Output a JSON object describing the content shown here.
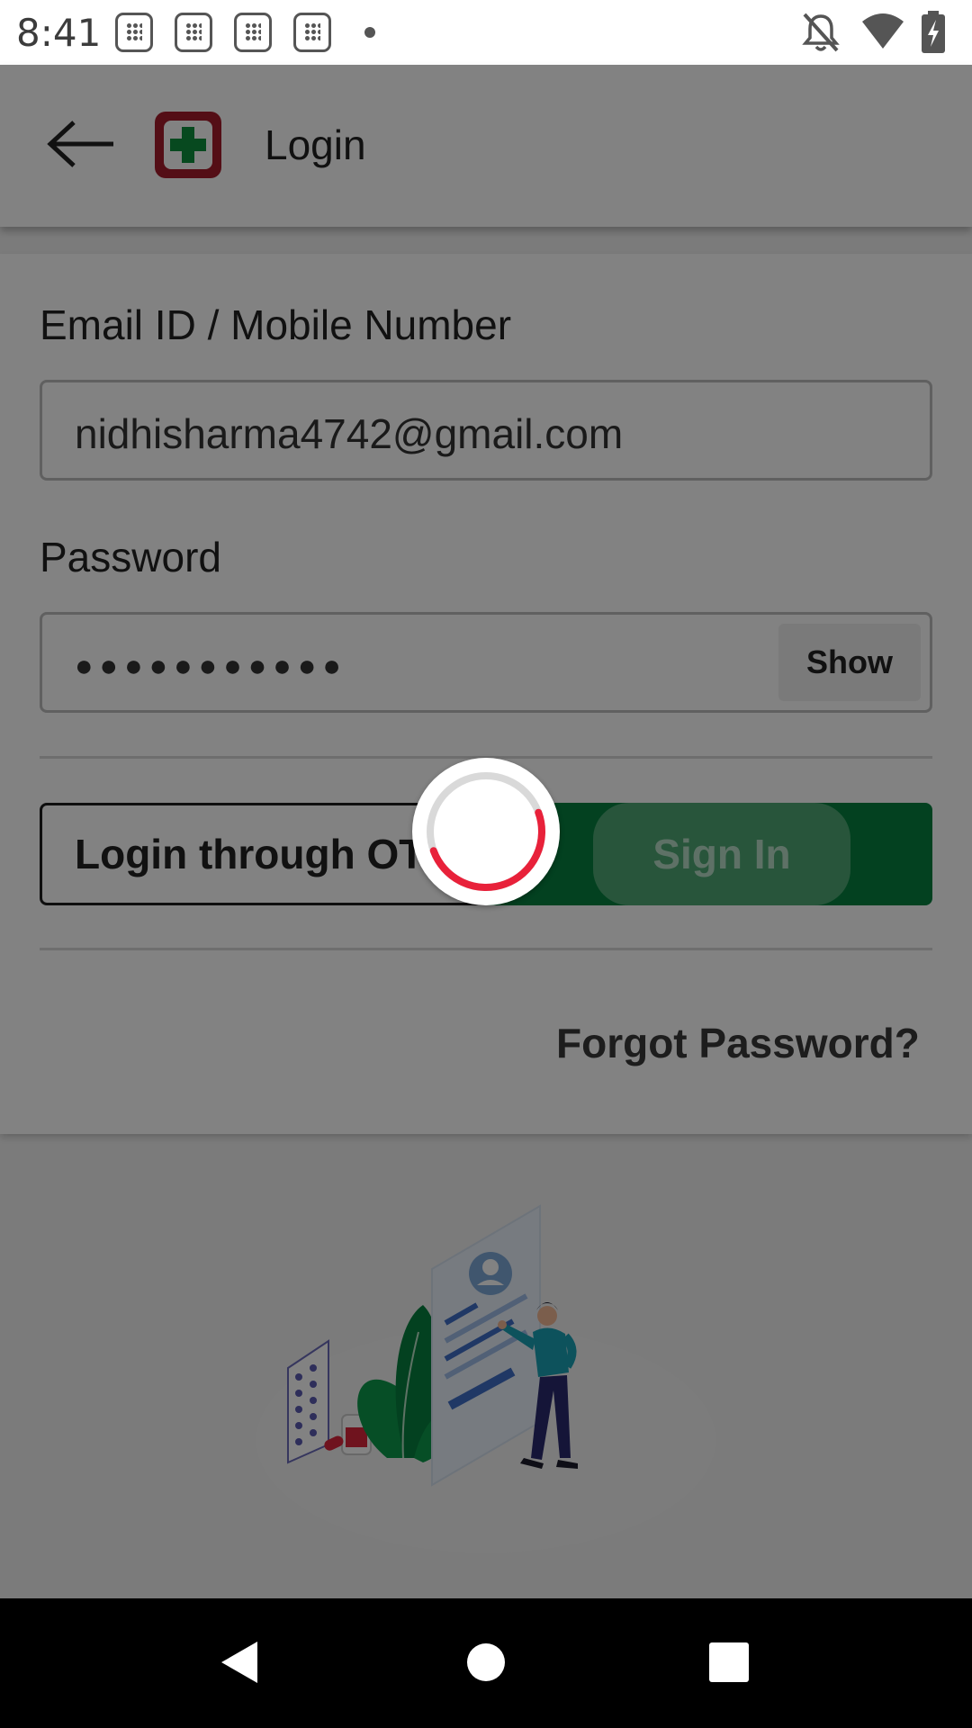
{
  "status_bar": {
    "time": "8:41",
    "left_icons": [
      "notification-icon",
      "notification-icon",
      "notification-icon",
      "notification-icon",
      "dot-icon"
    ],
    "right_icons": [
      "bell-off-icon",
      "wifi-icon",
      "battery-charging-icon"
    ]
  },
  "app_bar": {
    "back_icon": "arrow-left-icon",
    "logo_icon": "medical-cross-logo",
    "title": "Login"
  },
  "form": {
    "email_label": "Email ID / Mobile Number",
    "email_value": "nidhisharma4742@gmail.com",
    "password_label": "Password",
    "password_mask": "●●●●●●●●●●●",
    "show_label": "Show",
    "otp_label": "Login through OTP",
    "signin_label": "Sign In",
    "forgot_label": "Forgot Password?"
  },
  "loader": {
    "visible": true,
    "arc_color": "#e8213a",
    "track_color": "#d9d9d9"
  },
  "colors": {
    "brand_red": "#a51c2b",
    "brand_green": "#07803f",
    "overlay": "rgba(0,0,0,0.49)"
  },
  "nav_bar": {
    "icons": [
      "back-triangle-icon",
      "home-circle-icon",
      "recents-square-icon"
    ]
  }
}
